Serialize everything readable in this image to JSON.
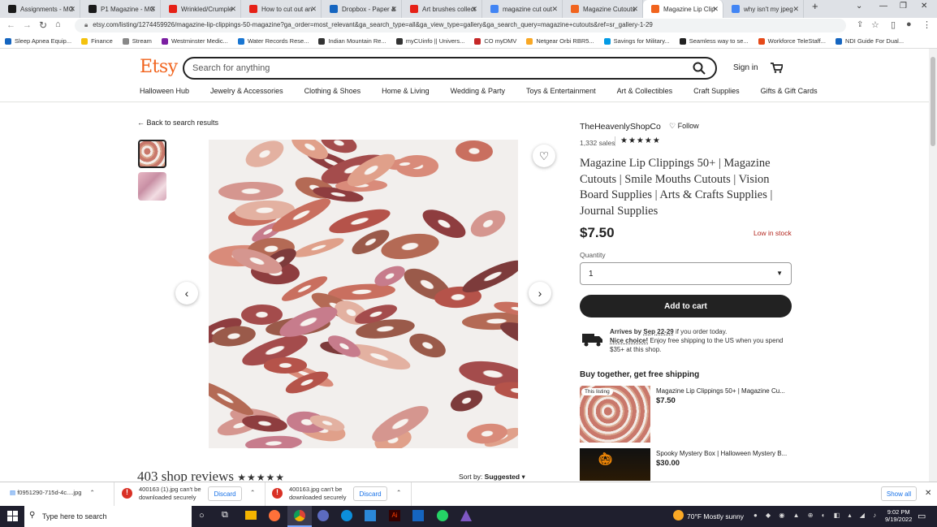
{
  "browser": {
    "tabs": [
      {
        "title": "Assignments - MG",
        "color": "#1a1a1a"
      },
      {
        "title": "P1 Magazine - MG",
        "color": "#1a1a1a"
      },
      {
        "title": "Wrinkled/Crumple",
        "color": "#e62117"
      },
      {
        "title": "How to cut out an",
        "color": "#e62117"
      },
      {
        "title": "Dropbox - Paper &",
        "color": "#1565c0"
      },
      {
        "title": "Art brushes collect",
        "color": "#e62117"
      },
      {
        "title": "magazine cut out",
        "color": "#4285f4"
      },
      {
        "title": "Magazine Cutouts",
        "color": "#f1641e"
      },
      {
        "title": "Magazine Lip Clip",
        "color": "#f1641e"
      },
      {
        "title": "why isn't my jpeg",
        "color": "#4285f4"
      }
    ],
    "url": "etsy.com/listing/1274459926/magazine-lip-clippings-50-magazine?ga_order=most_relevant&ga_search_type=all&ga_view_type=gallery&ga_search_query=magazine+cutouts&ref=sr_gallery-1-29",
    "bookmarks": [
      {
        "label": "Sleep Apnea Equip...",
        "color": "#1565c0"
      },
      {
        "label": "Finance",
        "color": "#f4c20d"
      },
      {
        "label": "Stream",
        "color": "#888"
      },
      {
        "label": "Westminster Medic...",
        "color": "#7b1fa2"
      },
      {
        "label": "Water Records Rese...",
        "color": "#1976d2"
      },
      {
        "label": "Indian Mountain Re...",
        "color": "#333"
      },
      {
        "label": "myCUinfo || Univers...",
        "color": "#333"
      },
      {
        "label": "CO myDMV",
        "color": "#c62828"
      },
      {
        "label": "Netgear Orbi RBR5...",
        "color": "#f9a825"
      },
      {
        "label": "Savings for Military...",
        "color": "#039be5"
      },
      {
        "label": "Seamless way to se...",
        "color": "#222"
      },
      {
        "label": "Workforce TeleStaff...",
        "color": "#e64a19"
      },
      {
        "label": "NDI Guide For Dual...",
        "color": "#1565c0"
      }
    ]
  },
  "etsy": {
    "logo": "Etsy",
    "search_placeholder": "Search for anything",
    "sign_in": "Sign in",
    "categories": [
      "Halloween Hub",
      "Jewelry & Accessories",
      "Clothing & Shoes",
      "Home & Living",
      "Wedding & Party",
      "Toys & Entertainment",
      "Art & Collectibles",
      "Craft Supplies",
      "Gifts & Gift Cards"
    ],
    "back_link": "Back to search results",
    "shop_name": "TheHeavenlyShopCo",
    "follow": "Follow",
    "sales": "1,332 sales",
    "rating_stars": 5,
    "title": "Magazine Lip Clippings 50+ | Magazine Cutouts | Smile Mouths Cutouts | Vision Board Supplies | Arts & Crafts Supplies | Journal Supplies",
    "price": "$7.50",
    "stock": "Low in stock",
    "quantity_label": "Quantity",
    "quantity_value": "1",
    "add_to_cart": "Add to cart",
    "arrives_prefix": "Arrives by ",
    "arrives_date": "Sep 22-29",
    "arrives_suffix": " if you order today.",
    "nice_choice": "Nice choice!",
    "shipping_text": " Enjoy free shipping to the US when you spend $35+ at this shop.",
    "buy_together": "Buy together, get free shipping",
    "bundle": [
      {
        "badge": "This listing",
        "title": "Magazine Lip Clippings 50+ | Magazine Cu...",
        "price": "$7.50"
      },
      {
        "badge": "",
        "title": "Spooky Mystery Box | Halloween Mystery B...",
        "price": "$30.00"
      }
    ],
    "reviews_heading": "403 shop reviews",
    "sort_label": "Sort by: ",
    "sort_value": "Suggested"
  },
  "downloads": [
    {
      "name": "f0951290-715d-4c....jpg"
    },
    {
      "name": "400163 (1).jpg can't be downloaded securely",
      "action": "Discard"
    },
    {
      "name": "400163.jpg can't be downloaded securely",
      "action": "Discard"
    }
  ],
  "downloads_show_all": "Show all",
  "taskbar": {
    "search_placeholder": "Type here to search",
    "weather": "70°F  Mostly sunny",
    "time": "9:02 PM",
    "date": "9/19/2022"
  }
}
